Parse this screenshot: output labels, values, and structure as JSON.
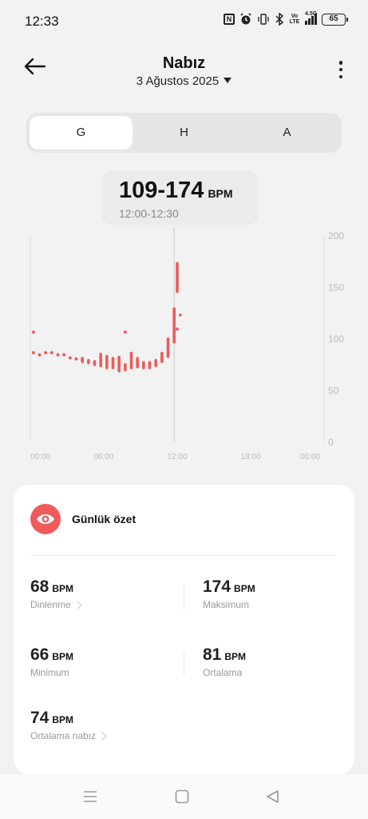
{
  "status": {
    "time": "12:33",
    "icons": [
      "nfc-icon",
      "alarm-icon",
      "vibrate-icon",
      "bluetooth-icon",
      "volte-icon",
      "signal-icon"
    ],
    "volte_label": "Vo LTE",
    "network": "4.5G",
    "battery": "65"
  },
  "header": {
    "title": "Nabız",
    "date": "3 Ağustos 2025"
  },
  "tabs": [
    {
      "label": "G",
      "active": true
    },
    {
      "label": "H",
      "active": false
    },
    {
      "label": "A",
      "active": false
    }
  ],
  "readout": {
    "value": "109-174",
    "unit": "BPM",
    "time": "12:00-12:30"
  },
  "chart_data": {
    "type": "bar",
    "x_ticks": [
      "00:00",
      "06:00",
      "12:00",
      "18:00",
      "00:00"
    ],
    "y_ticks": [
      "200",
      "150",
      "100",
      "50",
      "0"
    ],
    "ylim": [
      0,
      200
    ],
    "x_range_hours": [
      0,
      24
    ],
    "selected_hour": 11.75,
    "color": "#ef5b5b",
    "points": [
      {
        "h": 0.25,
        "v": 106
      },
      {
        "h": 0.25,
        "v": 86
      },
      {
        "h": 0.75,
        "v": 84
      },
      {
        "h": 1.25,
        "v": 86
      },
      {
        "h": 1.75,
        "v": 86
      },
      {
        "h": 2.25,
        "v": 84
      },
      {
        "h": 2.75,
        "v": 84
      },
      {
        "h": 3.25,
        "v": 81
      },
      {
        "h": 3.75,
        "v": 80
      },
      {
        "h": 4.25,
        "v": 79
      },
      {
        "h": 7.75,
        "v": 106
      },
      {
        "h": 12.0,
        "v": 109
      }
    ],
    "ranges": [
      {
        "h": 4.25,
        "lo": 76,
        "hi": 82
      },
      {
        "h": 4.75,
        "lo": 75,
        "hi": 80
      },
      {
        "h": 5.25,
        "lo": 73,
        "hi": 79
      },
      {
        "h": 5.75,
        "lo": 72,
        "hi": 86
      },
      {
        "h": 6.25,
        "lo": 70,
        "hi": 84
      },
      {
        "h": 6.75,
        "lo": 70,
        "hi": 82
      },
      {
        "h": 7.25,
        "lo": 67,
        "hi": 83
      },
      {
        "h": 7.75,
        "lo": 68,
        "hi": 76
      },
      {
        "h": 8.25,
        "lo": 70,
        "hi": 87
      },
      {
        "h": 8.75,
        "lo": 71,
        "hi": 82
      },
      {
        "h": 9.25,
        "lo": 70,
        "hi": 78
      },
      {
        "h": 9.75,
        "lo": 70,
        "hi": 78
      },
      {
        "h": 10.25,
        "lo": 72,
        "hi": 80
      },
      {
        "h": 10.75,
        "lo": 76,
        "hi": 87
      },
      {
        "h": 11.25,
        "lo": 81,
        "hi": 101
      },
      {
        "h": 11.75,
        "lo": 95,
        "hi": 130
      },
      {
        "h": 12.25,
        "lo": 122,
        "hi": 124
      },
      {
        "h": 12.0,
        "lo": 144,
        "hi": 174
      }
    ]
  },
  "summary": {
    "title": "Günlük özet",
    "icon": "eye-icon",
    "stats": [
      {
        "value": "68",
        "unit": "BPM",
        "label": "Dinlenme",
        "chevron": true
      },
      {
        "value": "174",
        "unit": "BPM",
        "label": "Maksimum",
        "chevron": false
      },
      {
        "value": "66",
        "unit": "BPM",
        "label": "Minimum",
        "chevron": false
      },
      {
        "value": "81",
        "unit": "BPM",
        "label": "Ortalama",
        "chevron": false
      },
      {
        "value": "74",
        "unit": "BPM",
        "label": "Ortalama nabız",
        "chevron": true
      }
    ]
  },
  "navbar": {
    "icons": [
      "menu-icon",
      "home-icon",
      "back-icon"
    ]
  }
}
